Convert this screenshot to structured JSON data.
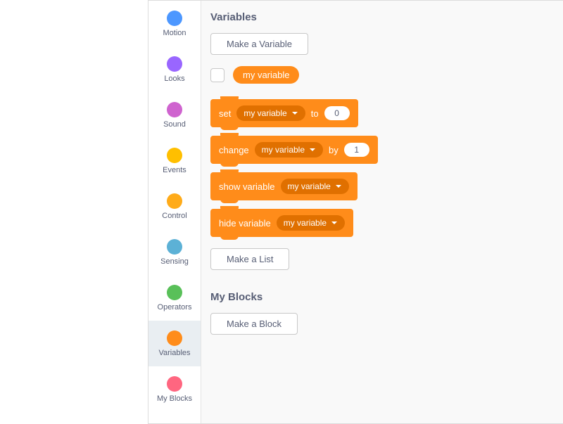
{
  "colors": {
    "motion": "#4c97ff",
    "looks": "#9966ff",
    "sound": "#cf63cf",
    "events": "#ffbf00",
    "control": "#ffab19",
    "sensing": "#5cb1d6",
    "operators": "#59c059",
    "variables": "#ff8c1a",
    "myblocks": "#ff6680"
  },
  "categories": [
    {
      "id": "motion",
      "label": "Motion"
    },
    {
      "id": "looks",
      "label": "Looks"
    },
    {
      "id": "sound",
      "label": "Sound"
    },
    {
      "id": "events",
      "label": "Events"
    },
    {
      "id": "control",
      "label": "Control"
    },
    {
      "id": "sensing",
      "label": "Sensing"
    },
    {
      "id": "operators",
      "label": "Operators"
    },
    {
      "id": "variables",
      "label": "Variables",
      "selected": true
    },
    {
      "id": "myblocks",
      "label": "My Blocks"
    }
  ],
  "variablesSection": {
    "title": "Variables",
    "makeVariable": "Make a Variable",
    "reporterName": "my variable",
    "blocks": {
      "set": {
        "pre": "set",
        "dropdown": "my variable",
        "mid": "to",
        "value": "0"
      },
      "change": {
        "pre": "change",
        "dropdown": "my variable",
        "mid": "by",
        "value": "1"
      },
      "show": {
        "pre": "show variable",
        "dropdown": "my variable"
      },
      "hide": {
        "pre": "hide variable",
        "dropdown": "my variable"
      }
    },
    "makeList": "Make a List"
  },
  "myBlocksSection": {
    "title": "My Blocks",
    "makeBlock": "Make a Block"
  }
}
